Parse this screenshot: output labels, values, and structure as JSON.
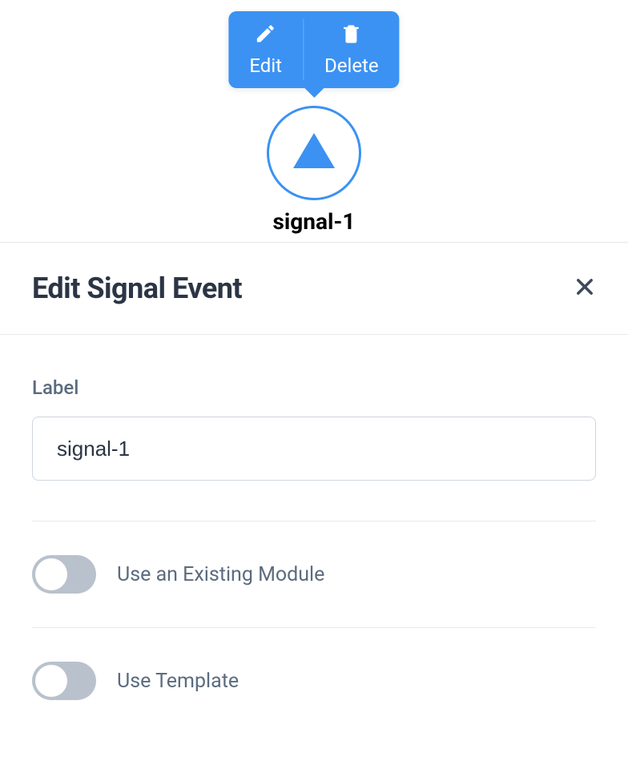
{
  "popover": {
    "edit_label": "Edit",
    "delete_label": "Delete"
  },
  "node": {
    "label": "signal-1"
  },
  "panel": {
    "title": "Edit Signal Event"
  },
  "form": {
    "label_field_label": "Label",
    "label_value": "signal-1",
    "use_existing_module_label": "Use an Existing Module",
    "use_existing_module_on": false,
    "use_template_label": "Use Template",
    "use_template_on": false
  }
}
